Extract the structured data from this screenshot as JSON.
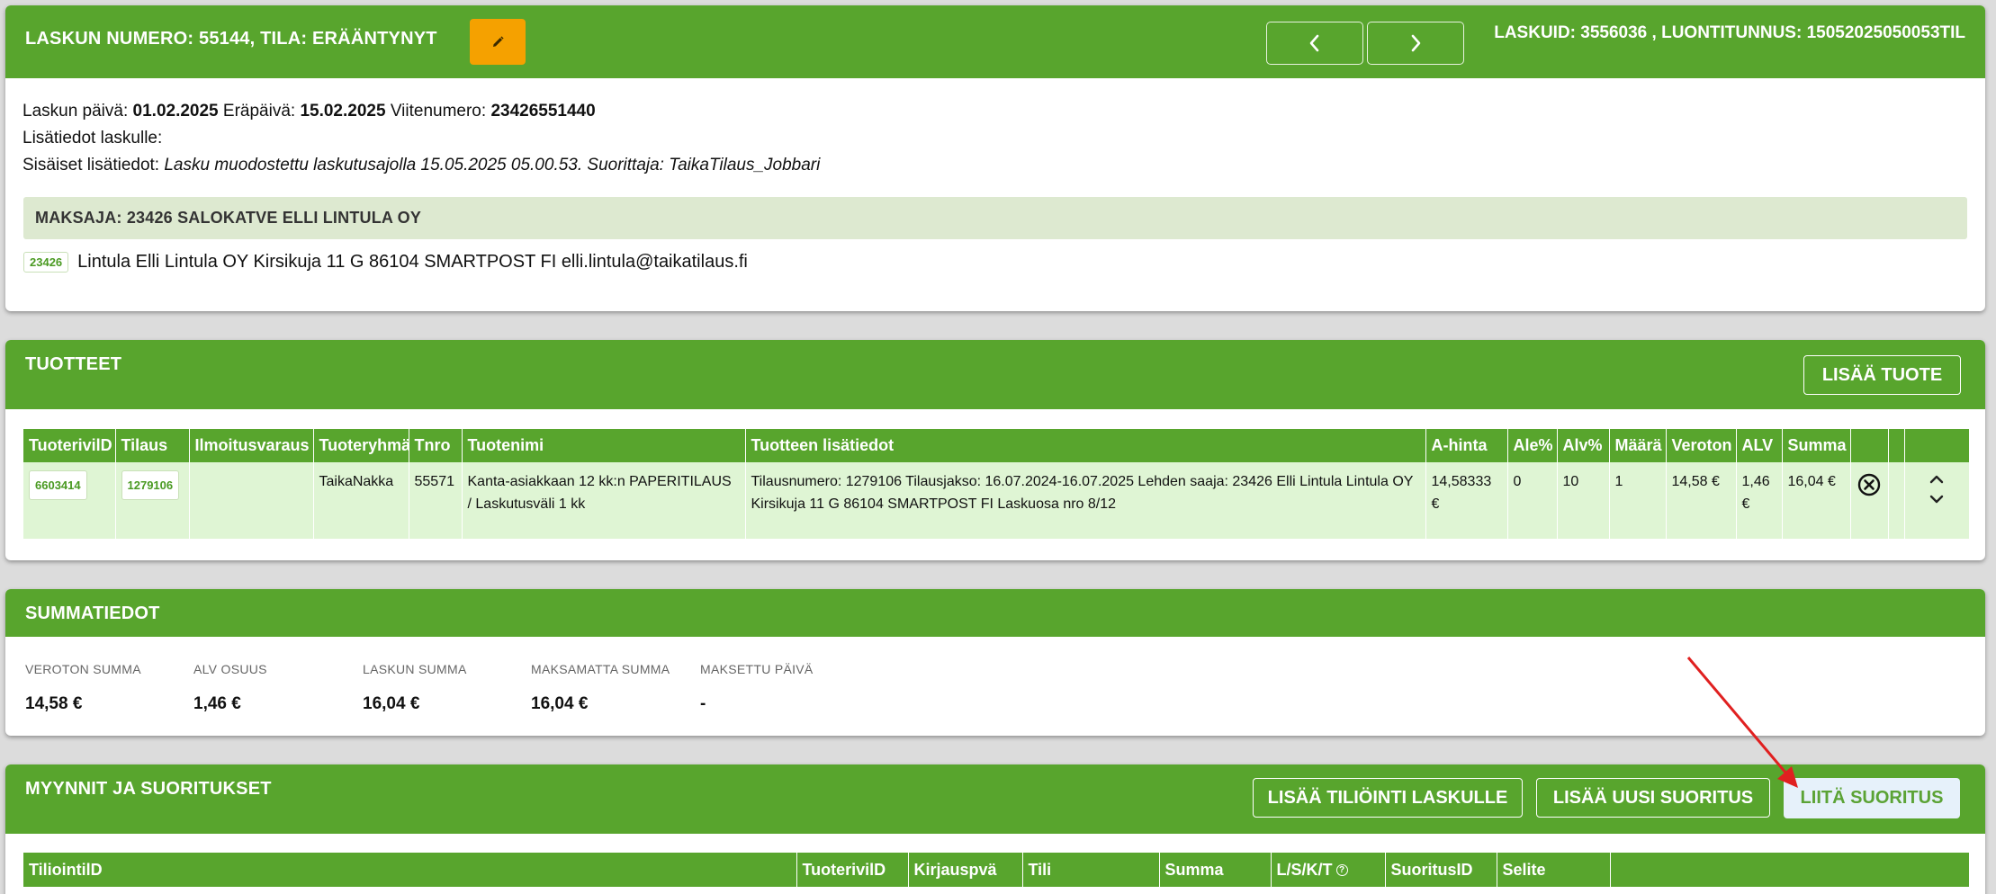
{
  "invoice_header": {
    "title_prefix": "LASKUN NUMERO: ",
    "number": "55144",
    "status_prefix": ", TILA: ",
    "status": "ERÄÄNTYNYT",
    "ids_text": "LASKUID: 3556036 , LUONTITUNNUS: 15052025050053TIL"
  },
  "invoice_info": {
    "date_label": "Laskun päivä: ",
    "date": "01.02.2025",
    "due_label": " Eräpäivä: ",
    "due": "15.02.2025",
    "ref_label": " Viitenumero: ",
    "ref": "23426551440",
    "extra_label": "Lisätiedot laskulle:",
    "internal_label": "Sisäiset lisätiedot: ",
    "internal_text": "Lasku muodostettu laskutusajolla 15.05.2025 05.00.53. Suorittaja: TaikaTilaus_Jobbari"
  },
  "payer": {
    "bar_label": "MAKSAJA: ",
    "bar_value": "23426 SALOKATVE ELLI LINTULA OY",
    "id_tag": "23426",
    "details": "Lintula Elli Lintula OY Kirsikuja 11 G 86104 SMARTPOST FI elli.lintula@taikatilaus.fi"
  },
  "products": {
    "title": "TUOTTEET",
    "add_button": "LISÄÄ TUOTE",
    "columns": [
      "TuoterivilD",
      "Tilaus",
      "Ilmoitusvaraus",
      "Tuoteryhmä",
      "Tnro",
      "Tuotenimi",
      "Tuotteen lisätiedot",
      "A-hinta",
      "Ale%",
      "Alv%",
      "Määrä",
      "Veroton",
      "ALV",
      "Summa",
      "",
      "",
      ""
    ],
    "rows": [
      {
        "row_id": "6603414",
        "order": "1279106",
        "ad_reservation": "",
        "group": "TaikaNakka",
        "tnro": "55571",
        "name": "Kanta-asiakkaan 12 kk:n PAPERITILAUS / Laskutusväli 1 kk",
        "details": "Tilausnumero: 1279106 Tilausjakso: 16.07.2024-16.07.2025 Lehden saaja: 23426 Elli Lintula Lintula OY Kirsikuja 11 G 86104 SMARTPOST FI Laskuosa nro 8/12",
        "unit_price": "14,58333 €",
        "discount": "0",
        "vat_pct": "10",
        "qty": "1",
        "net": "14,58 €",
        "vat": "1,46 €",
        "sum": "16,04 €"
      }
    ]
  },
  "summary": {
    "title": "SUMMATIEDOT",
    "items": [
      {
        "label": "VEROTON SUMMA",
        "value": "14,58 €"
      },
      {
        "label": "ALV OSUUS",
        "value": "1,46 €"
      },
      {
        "label": "LASKUN SUMMA",
        "value": "16,04 €"
      },
      {
        "label": "MAKSAMATTA SUMMA",
        "value": "16,04 €"
      },
      {
        "label": "MAKSETTU PÄIVÄ",
        "value": "-"
      }
    ]
  },
  "payments": {
    "title": "MYYNNIT JA SUORITUKSET",
    "btn_accounting": "LISÄÄ TILIÖINTI LASKULLE",
    "btn_new_payment": "LISÄÄ UUSI SUORITUS",
    "btn_attach_payment": "LIITÄ SUORITUS",
    "columns": [
      "TiliointilD",
      "TuoterivilD",
      "Kirjauspvä",
      "Tili",
      "Summa",
      "L/S/K/T",
      "SuoritusID",
      "Selite",
      ""
    ]
  },
  "colors": {
    "header_green": "#58a52d",
    "edit_orange": "#f5a100",
    "row_green": "#dff5d4",
    "payer_bar": "#dde9d0",
    "annotation_red": "#e02020"
  },
  "icons": {
    "edit": "pencil-icon",
    "prev": "chevron-left-icon",
    "next": "chevron-right-icon",
    "remove": "circle-x-icon",
    "up": "chevron-up-icon",
    "down": "chevron-down-icon",
    "help": "question-circle-icon"
  }
}
